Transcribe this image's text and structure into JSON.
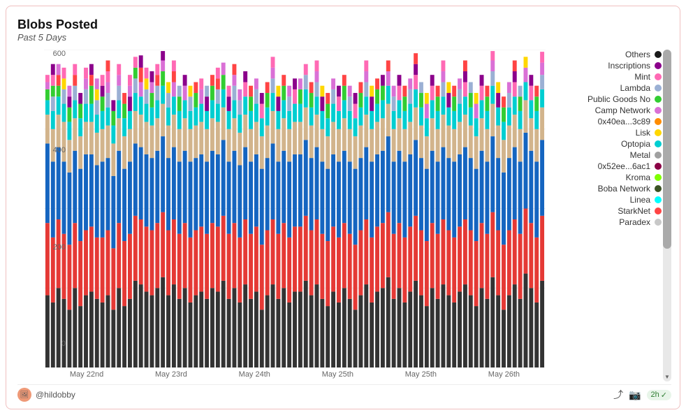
{
  "card": {
    "title": "Blobs Posted",
    "subtitle": "Past 5 Days"
  },
  "chart": {
    "y_labels": [
      "600",
      "400",
      "200",
      "0"
    ],
    "x_labels": [
      "May 22nd",
      "May 23rd",
      "May 24th",
      "May 25th",
      "May 25th",
      "May 26th"
    ]
  },
  "legend": {
    "items": [
      {
        "label": "Others",
        "color": "#1a1a1a"
      },
      {
        "label": "Inscriptions",
        "color": "#8B008B"
      },
      {
        "label": "Mint",
        "color": "#FF69B4"
      },
      {
        "label": "Lambda",
        "color": "#9BB0D4"
      },
      {
        "label": "Public Goods No",
        "color": "#32CD32"
      },
      {
        "label": "Camp Network",
        "color": "#DA70D6"
      },
      {
        "label": "0x40ea...3c89",
        "color": "#FF8C00"
      },
      {
        "label": "Lisk",
        "color": "#FFD700"
      },
      {
        "label": "Optopia",
        "color": "#00CED1"
      },
      {
        "label": "Metal",
        "color": "#A0A0A0"
      },
      {
        "label": "0x52ee...6ac1",
        "color": "#8B0045"
      },
      {
        "label": "Kroma",
        "color": "#7FFF00"
      },
      {
        "label": "Boba Network",
        "color": "#3B5323"
      },
      {
        "label": "Linea",
        "color": "#00FFFF"
      },
      {
        "label": "StarkNet",
        "color": "#FF4444"
      },
      {
        "label": "Paradex",
        "color": "#C8C8C8"
      }
    ]
  },
  "footer": {
    "username": "@hildobby",
    "badge": "2h",
    "icons": [
      "share-icon",
      "camera-icon",
      "check-icon"
    ]
  }
}
